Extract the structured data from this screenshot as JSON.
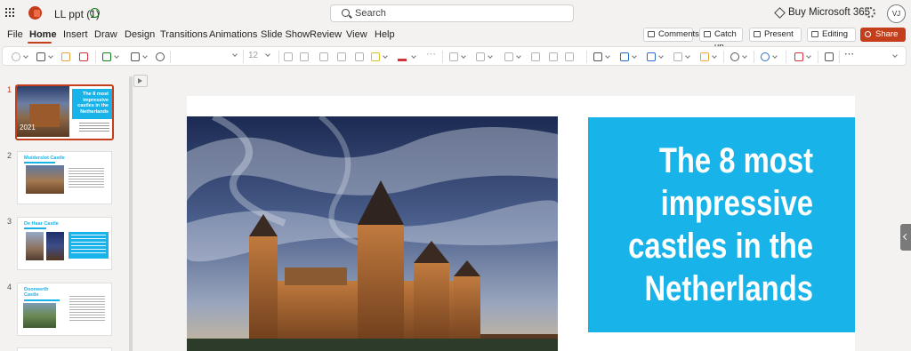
{
  "titlebar": {
    "doc_title": "LL ppt (1)",
    "search_placeholder": "Search",
    "buy_label": "Buy Microsoft 365",
    "avatar_initials": "VJ"
  },
  "menu": {
    "tabs": [
      "File",
      "Home",
      "Insert",
      "Draw",
      "Design",
      "Transitions",
      "Animations",
      "Slide Show",
      "Review",
      "View",
      "Help"
    ],
    "active": "Home"
  },
  "actions": {
    "comments": "Comments",
    "catch_up": "Catch up",
    "present": "Present",
    "editing": "Editing",
    "share": "Share"
  },
  "ribbon": {
    "font_name": "",
    "font_size": "12"
  },
  "slides": {
    "numbers": [
      "1",
      "2",
      "3",
      "4"
    ],
    "thumb1": {
      "year": "2021",
      "title": "The 8 most impressive castles in the Netherlands"
    },
    "thumb2": {
      "title": "Muiderslot Castle"
    },
    "thumb3": {
      "title": "De Haar Castle"
    },
    "thumb4": {
      "title": "Doorwerth Castle"
    }
  },
  "main_slide": {
    "title": "The 8 most impressive castles in the Netherlands"
  },
  "colors": {
    "accent": "#c43e1c",
    "title_box": "#17b3e9",
    "slide_bg": "#ffffff"
  },
  "icons": [
    "app-launcher-icon",
    "powerpoint-logo-icon",
    "saved-sync-icon",
    "search-icon",
    "diamond-icon",
    "gear-icon",
    "undo-icon",
    "paste-icon",
    "format-painter-icon",
    "delete-icon",
    "new-slide-icon",
    "layout-icon",
    "hide-slide-icon",
    "bullets-icon",
    "numbering-icon",
    "align-icon",
    "shapes-icon",
    "picture-icon",
    "find-icon",
    "dictate-icon",
    "designer-icon",
    "collapse-pane-icon"
  ]
}
